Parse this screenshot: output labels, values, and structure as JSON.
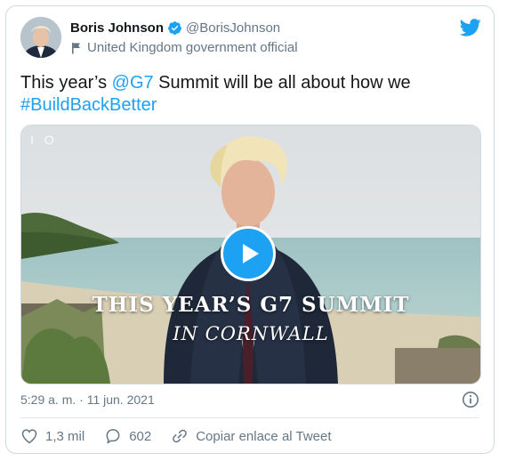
{
  "author": {
    "name": "Boris Johnson",
    "handle": "@BorisJohnson",
    "label": "United Kingdom government official"
  },
  "tweet": {
    "text_before": "This year’s ",
    "mention": "@G7",
    "text_after": " Summit will be all about how we",
    "hashtag": "#BuildBackBetter"
  },
  "media": {
    "type": "video",
    "channel_mark": "I O",
    "caption_line1": "THIS YEAR’S G7 SUMMIT",
    "caption_line2": "IN CORNWALL"
  },
  "timestamp": "5:29 a. m. · 11 jun. 2021",
  "actions": {
    "likes": "1,3 mil",
    "replies": "602",
    "copy_link": "Copiar enlace al Tweet"
  },
  "colors": {
    "accent": "#1da1f2",
    "text": "#14171a",
    "secondary": "#657786",
    "border": "#cfd9de"
  },
  "icons": {
    "verified": "verified-badge-icon",
    "label": "flag-icon",
    "brand": "twitter-bird-icon",
    "play": "play-icon",
    "info": "info-icon",
    "like": "heart-icon",
    "reply": "reply-bubble-icon",
    "copy": "link-icon"
  }
}
